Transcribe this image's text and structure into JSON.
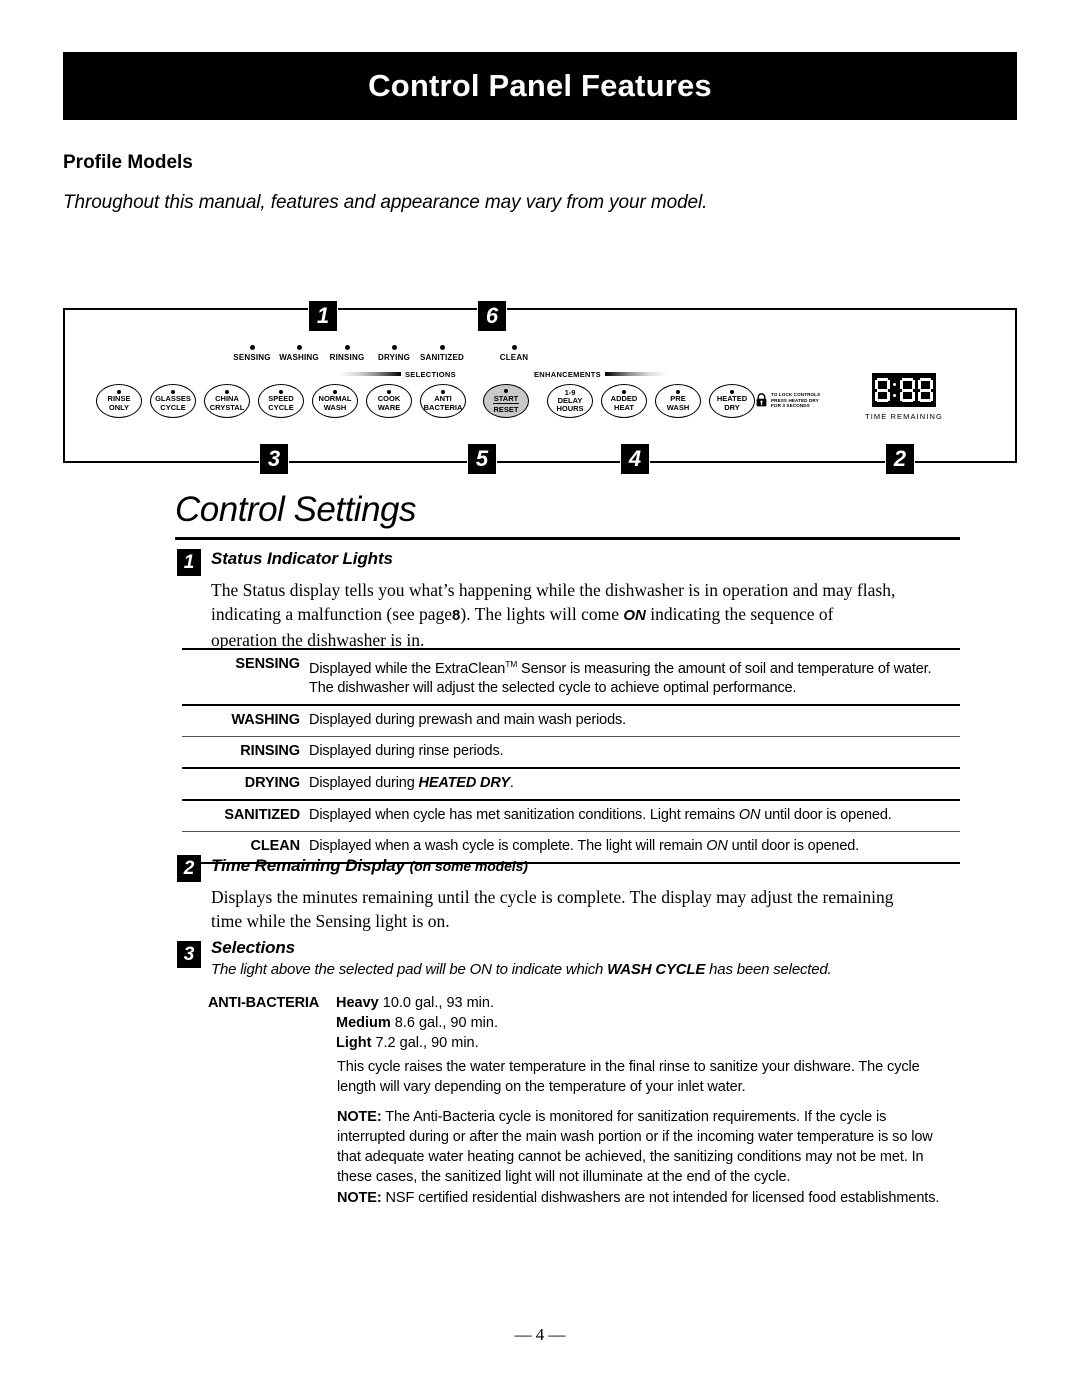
{
  "header": {
    "title": "Control Panel Features"
  },
  "intro": {
    "models_heading": "Profile Models",
    "note": "Throughout this manual, features and appearance may vary from your model."
  },
  "panel": {
    "callouts": [
      "1",
      "6",
      "3",
      "5",
      "4",
      "2"
    ],
    "status_lights": [
      "SENSING",
      "WASHING",
      "RINSING",
      "DRYING",
      "SANITIZED",
      "CLEAN"
    ],
    "section_labels": {
      "selections": "SELECTIONS",
      "enhancements": "ENHANCEMENTS"
    },
    "cycle_pads": [
      {
        "line1": "RINSE",
        "line2": "ONLY"
      },
      {
        "line1": "GLASSES",
        "line2": "CYCLE"
      },
      {
        "line1": "CHINA",
        "line2": "CRYSTAL"
      },
      {
        "line1": "SPEED",
        "line2": "CYCLE"
      },
      {
        "line1": "NORMAL",
        "line2": "WASH"
      },
      {
        "line1": "COOK",
        "line2": "WARE"
      },
      {
        "line1": "ANTI",
        "line2": "BACTERIA"
      }
    ],
    "start_pad": {
      "line1": "START",
      "line2": "RESET"
    },
    "enhancement_pads": [
      {
        "line1": "1-9",
        "line2": "DELAY",
        "line3": "HOURS"
      },
      {
        "line1": "ADDED",
        "line2": "HEAT"
      },
      {
        "line1": "PRE",
        "line2": "WASH"
      },
      {
        "line1": "HEATED",
        "line2": "DRY"
      }
    ],
    "lock_note": [
      "TO LOCK CONTROLS",
      "PRESS HEATED DRY",
      "FOR 3 SECONDS"
    ],
    "display": {
      "value": "8:88",
      "caption": "TIME REMAINING"
    }
  },
  "control_settings": {
    "title": "Control Settings",
    "section1": {
      "number": "1",
      "heading": "Status Indicator Lights",
      "paragraph_l1": "The Status display tells you what’s happening while the dishwasher is in operation and may flash,",
      "paragraph_l2_a": "indicating a malfunction (see page",
      "paragraph_l2_page": "8",
      "paragraph_l2_b": "). The lights will come",
      "paragraph_l2_on": "ON",
      "paragraph_l2_c": "indicating the sequence of",
      "paragraph_l3": "operation the dishwasher is in.",
      "table": [
        {
          "label": "SENSING",
          "line1_a": "Displayed while the ExtraClean",
          "line1_tm": "TM",
          "line1_b": " Sensor is measuring the amount of soil and temperature of water.",
          "line2": "The dishwasher will adjust the selected cycle to achieve optimal performance."
        },
        {
          "label": "WASHING",
          "text": "Displayed during prewash and main wash periods."
        },
        {
          "label": "RINSING",
          "text": "Displayed during rinse periods."
        },
        {
          "label": "DRYING",
          "text_a": "Displayed during ",
          "bold": "HEATED DRY",
          "text_b": "."
        },
        {
          "label": "SANITIZED",
          "text_a": "Displayed when cycle has met sanitization conditions. Light remains ",
          "ital": "ON",
          "text_b": " until door is opened."
        },
        {
          "label": "CLEAN",
          "text_a": "Displayed when a wash cycle is complete. The light will remain ",
          "ital": "ON",
          "text_b": " until door is opened."
        }
      ]
    },
    "section2": {
      "number": "2",
      "heading": "Time Remaining Display",
      "heading_sub": "(on some models)",
      "paragraph_l1": "Displays the minutes remaining until the cycle is complete. The display may adjust the remaining",
      "paragraph_l2": "time while the Sensing light is on."
    },
    "section3": {
      "number": "3",
      "heading": "Selections",
      "subline_a": "The light above the selected pad will be ON to indicate which ",
      "subline_bold": "WASH CYCLE",
      "subline_b": " has been selected.",
      "anti_bacteria": {
        "key": "ANTI-BACTERIA",
        "rows": [
          {
            "level": "Heavy",
            "spec": " 10.0 gal., 93 min."
          },
          {
            "level": "Medium",
            "spec": " 8.6 gal., 90 min."
          },
          {
            "level": "Light",
            "spec": " 7.2 gal., 90 min."
          }
        ]
      },
      "description_l1": "This cycle raises the water temperature in the final rinse to sanitize your dishware. The cycle",
      "description_l2": "length will vary depending on the temperature of your inlet water.",
      "note1_label": "NOTE:",
      "note1_l1": " The Anti-Bacteria cycle is monitored for sanitization requirements. If the cycle is",
      "note1_l2": "interrupted during or after the main wash portion or if the incoming water temperature is so low",
      "note1_l3": "that adequate water heating cannot be achieved, the sanitizing conditions may not be met. In",
      "note1_l4": "these cases, the sanitized light will not illuminate at the end of the cycle.",
      "note2_label": "NOTE:",
      "note2_text": " NSF certified residential dishwashers are not intended for licensed food establishments."
    }
  },
  "footer": {
    "page": "— 4 —"
  }
}
